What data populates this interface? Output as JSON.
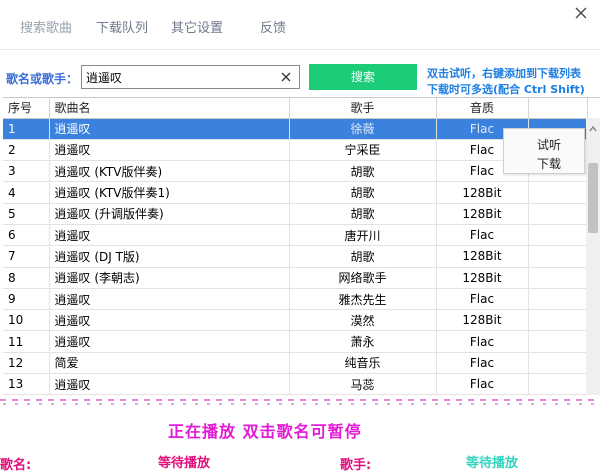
{
  "tabs": [
    "搜索歌曲",
    "下载队列",
    "其它设置",
    "反馈"
  ],
  "search": {
    "label": "歌名或歌手：",
    "value": "逍遥叹",
    "button_label": "搜索",
    "hint_line1": "双击试听，右键添加到下载列表",
    "hint_line2": "下载时可多选(配合 Ctrl Shift)"
  },
  "table": {
    "headers": [
      "序号",
      "歌曲名",
      "歌手",
      "音质"
    ],
    "selected_index": 0,
    "rows": [
      [
        "1",
        "逍遥叹",
        "徐薇",
        "Flac"
      ],
      [
        "2",
        "逍遥叹",
        "宁采臣",
        "Flac"
      ],
      [
        "3",
        "逍遥叹 (KTV版伴奏)",
        "胡歌",
        "Flac"
      ],
      [
        "4",
        "逍遥叹 (KTV版伴奏1)",
        "胡歌",
        "128Bit"
      ],
      [
        "5",
        "逍遥叹 (升调版伴奏)",
        "胡歌",
        "128Bit"
      ],
      [
        "6",
        "逍遥叹",
        "唐开川",
        "Flac"
      ],
      [
        "7",
        "逍遥叹 (DJ T版)",
        "胡歌",
        "128Bit"
      ],
      [
        "8",
        "逍遥叹 (李朝志)",
        "网络歌手",
        "128Bit"
      ],
      [
        "9",
        "逍遥叹",
        "雅杰先生",
        "Flac"
      ],
      [
        "10",
        "逍遥叹",
        "漠然",
        "128Bit"
      ],
      [
        "11",
        "逍遥叹",
        "萧永",
        "Flac"
      ],
      [
        "12",
        "简爱",
        "纯音乐",
        "Flac"
      ],
      [
        "13",
        "逍遥叹",
        "马蕊",
        "Flac"
      ]
    ]
  },
  "context_menu": [
    "试听",
    "下载"
  ],
  "player": {
    "status": "正在播放    双击歌名可暂停",
    "song_label": "歌名:",
    "song_value": "等待播放",
    "singer_label": "歌手:",
    "singer_value": "等待播放"
  },
  "colors": {
    "accent_blue": "#3b82de",
    "search_button": "#1dcc78",
    "hint_text": "#1d7fe3",
    "status_magenta": "#e31ad6",
    "label_pink": "#e0107c",
    "waiting_cyan": "#34d4c0"
  }
}
